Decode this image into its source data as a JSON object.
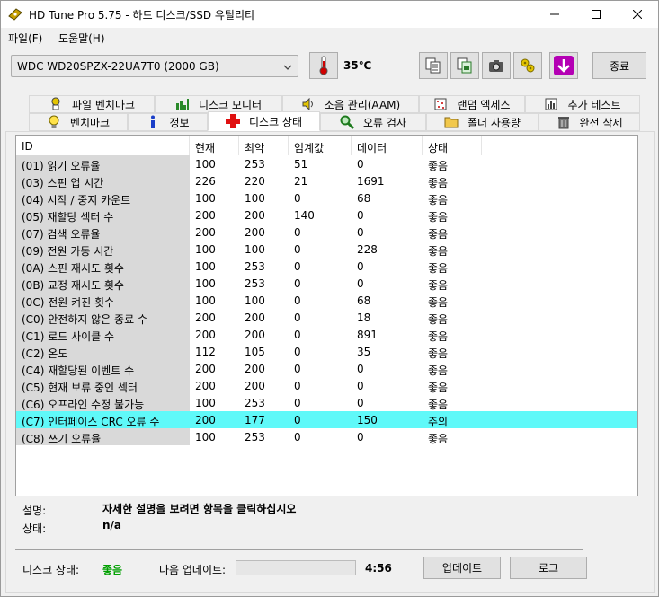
{
  "window": {
    "title": "HD Tune Pro 5.75 - 하드 디스크/SSD 유틸리티"
  },
  "menu": [
    "파일(F)",
    "도움말(H)"
  ],
  "toolbar": {
    "drive": "WDC WD20SPZX-22UA7T0 (2000 GB)",
    "temperature": "35℃",
    "exit_label": "종료",
    "icons": [
      "copy-icon",
      "save-icon",
      "camera-icon",
      "options-icon",
      "download-icon"
    ]
  },
  "tabs": {
    "row1": [
      {
        "label": "파일 벤치마크",
        "icon": "file-benchmark-icon"
      },
      {
        "label": "디스크 모니터",
        "icon": "disk-monitor-icon"
      },
      {
        "label": "소음 관리(AAM)",
        "icon": "speaker-icon"
      },
      {
        "label": "랜덤 엑세스",
        "icon": "random-access-icon"
      },
      {
        "label": "추가 테스트",
        "icon": "extra-tests-icon"
      }
    ],
    "row2": [
      {
        "label": "벤치마크",
        "icon": "lightbulb-icon"
      },
      {
        "label": "정보",
        "icon": "info-icon"
      },
      {
        "label": "디스크 상태",
        "icon": "health-cross-icon"
      },
      {
        "label": "오류 검사",
        "icon": "magnifier-icon"
      },
      {
        "label": "폴더 사용량",
        "icon": "folder-icon"
      },
      {
        "label": "완전 삭제",
        "icon": "trash-icon"
      }
    ]
  },
  "table": {
    "headers": [
      "ID",
      "현재",
      "최악",
      "임계값",
      "데이터",
      "상태"
    ],
    "rows": [
      [
        "(01) 읽기 오류율",
        "100",
        "253",
        "51",
        "0",
        "좋음"
      ],
      [
        "(03) 스핀 업 시간",
        "226",
        "220",
        "21",
        "1691",
        "좋음"
      ],
      [
        "(04) 시작 / 중지 카운트",
        "100",
        "100",
        "0",
        "68",
        "좋음"
      ],
      [
        "(05) 재할당 섹터 수",
        "200",
        "200",
        "140",
        "0",
        "좋음"
      ],
      [
        "(07) 검색 오류율",
        "200",
        "200",
        "0",
        "0",
        "좋음"
      ],
      [
        "(09) 전원 가동 시간",
        "100",
        "100",
        "0",
        "228",
        "좋음"
      ],
      [
        "(0A) 스핀 재시도 횟수",
        "100",
        "253",
        "0",
        "0",
        "좋음"
      ],
      [
        "(0B) 교정 재시도 횟수",
        "100",
        "253",
        "0",
        "0",
        "좋음"
      ],
      [
        "(0C) 전원 켜진 횟수",
        "100",
        "100",
        "0",
        "68",
        "좋음"
      ],
      [
        "(C0) 안전하지 않은 종료 수",
        "200",
        "200",
        "0",
        "18",
        "좋음"
      ],
      [
        "(C1) 로드 사이클 수",
        "200",
        "200",
        "0",
        "891",
        "좋음"
      ],
      [
        "(C2) 온도",
        "112",
        "105",
        "0",
        "35",
        "좋음"
      ],
      [
        "(C4) 재할당된 이벤트 수",
        "200",
        "200",
        "0",
        "0",
        "좋음"
      ],
      [
        "(C5) 현재 보류 중인 섹터",
        "200",
        "200",
        "0",
        "0",
        "좋음"
      ],
      [
        "(C6) 오프라인 수정 불가능",
        "100",
        "253",
        "0",
        "0",
        "좋음"
      ],
      [
        "(C7) 인터페이스 CRC 오류 수",
        "200",
        "177",
        "0",
        "150",
        "주의"
      ],
      [
        "(C8) 쓰기 오류율",
        "100",
        "253",
        "0",
        "0",
        "좋음"
      ]
    ],
    "warning_row_index": 15,
    "warning_color": "#5ff9f9"
  },
  "details": {
    "description_label": "설명:",
    "description_value": "자세한 설명을 보려면 항목을 클릭하십시오",
    "status_label": "상태:",
    "status_value": "n/a"
  },
  "footer": {
    "disk_status_label": "디스크 상태:",
    "disk_status_value": "좋음",
    "disk_status_color": "#00a000",
    "next_update_label": "다음 업데이트:",
    "countdown": "4:56",
    "progress": 0,
    "update_button": "업데이트",
    "log_button": "로그"
  }
}
